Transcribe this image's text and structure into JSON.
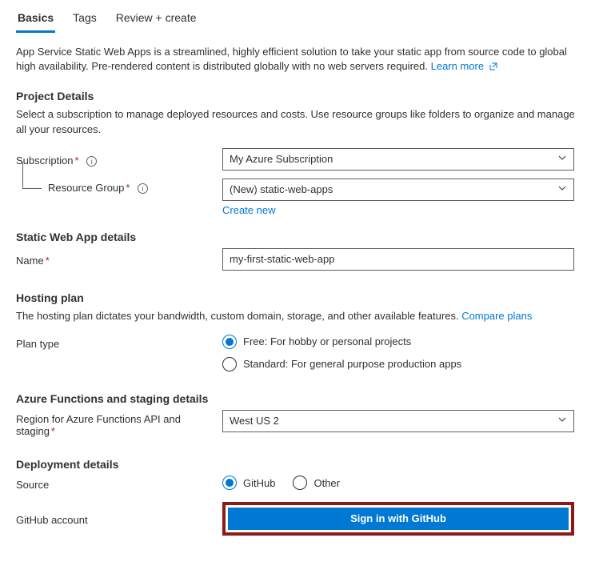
{
  "tabs": {
    "basics": "Basics",
    "tags": "Tags",
    "review": "Review + create"
  },
  "intro": {
    "text": "App Service Static Web Apps is a streamlined, highly efficient solution to take your static app from source code to global high availability. Pre-rendered content is distributed globally with no web servers required.",
    "learn_more": "Learn more"
  },
  "project": {
    "heading": "Project Details",
    "desc": "Select a subscription to manage deployed resources and costs. Use resource groups like folders to organize and manage all your resources.",
    "subscription_label": "Subscription",
    "subscription_value": "My Azure Subscription",
    "rg_label": "Resource Group",
    "rg_value": "(New) static-web-apps",
    "create_new": "Create new"
  },
  "details": {
    "heading": "Static Web App details",
    "name_label": "Name",
    "name_value": "my-first-static-web-app"
  },
  "hosting": {
    "heading": "Hosting plan",
    "desc": "The hosting plan dictates your bandwidth, custom domain, storage, and other available features.",
    "compare": "Compare plans",
    "plan_type_label": "Plan type",
    "free_label": "Free: For hobby or personal projects",
    "standard_label": "Standard: For general purpose production apps"
  },
  "functions": {
    "heading": "Azure Functions and staging details",
    "region_label": "Region for Azure Functions API and staging",
    "region_value": "West US 2"
  },
  "deployment": {
    "heading": "Deployment details",
    "source_label": "Source",
    "github_label": "GitHub",
    "other_label": "Other",
    "gh_account_label": "GitHub account",
    "signin_label": "Sign in with GitHub"
  }
}
